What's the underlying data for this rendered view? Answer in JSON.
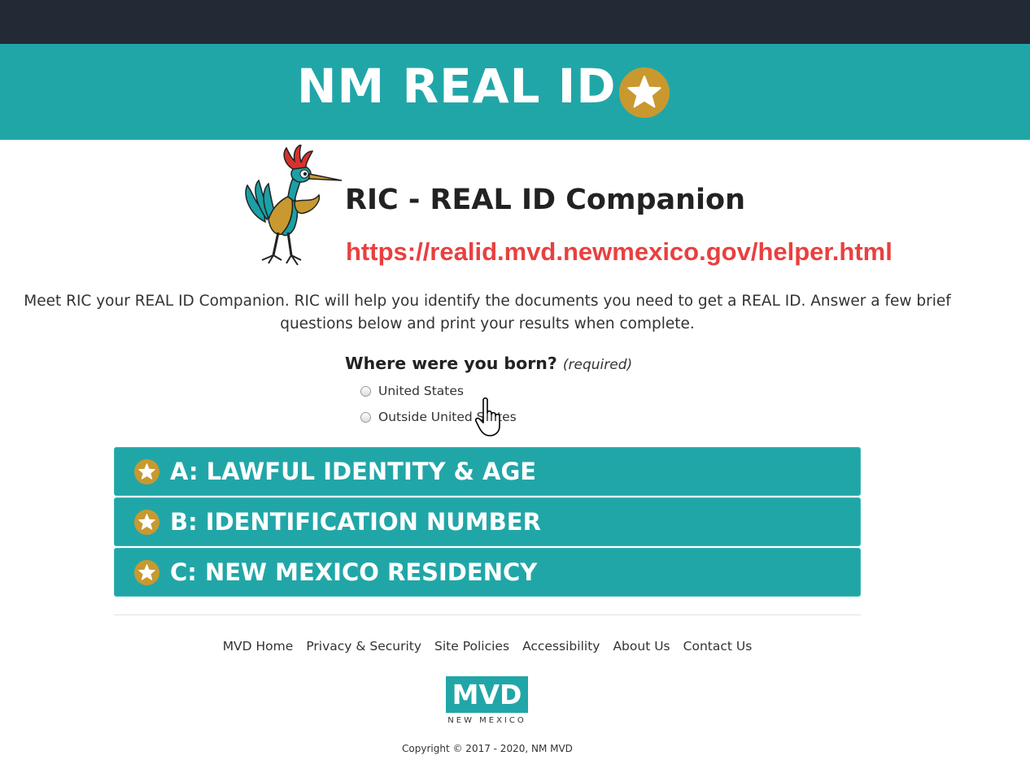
{
  "banner": {
    "title": "NM REAL ID",
    "icon": "star-icon",
    "background": "#21a6a8",
    "icon_color": "#c9992f"
  },
  "companion": {
    "title": "RIC - REAL ID Companion",
    "url": "https://realid.mvd.newmexico.gov/helper.html",
    "mascot": "roadrunner-mascot",
    "url_color": "#e8403f"
  },
  "intro": "Meet RIC your REAL ID Companion. RIC will help you identify the documents you need to get a REAL ID. Answer a few brief questions below and print your results when complete.",
  "question": {
    "text": "Where were you born?",
    "required_note": "(required)",
    "options": [
      "United States",
      "Outside United States"
    ]
  },
  "sections": [
    {
      "label": "A: LAWFUL IDENTITY & AGE",
      "icon": "star-icon"
    },
    {
      "label": "B: IDENTIFICATION NUMBER",
      "icon": "star-icon"
    },
    {
      "label": "C: NEW MEXICO RESIDENCY",
      "icon": "star-icon"
    }
  ],
  "footer": {
    "links": [
      "MVD Home",
      "Privacy & Security",
      "Site Policies",
      "Accessibility",
      "About Us",
      "Contact Us"
    ],
    "logo": {
      "main": "MVD",
      "sub": "NEW MEXICO"
    },
    "copyright": "Copyright © 2017 - 2020, NM MVD"
  },
  "colors": {
    "topbar": "#222a35",
    "teal": "#21a6a8",
    "gold": "#c9992f"
  }
}
